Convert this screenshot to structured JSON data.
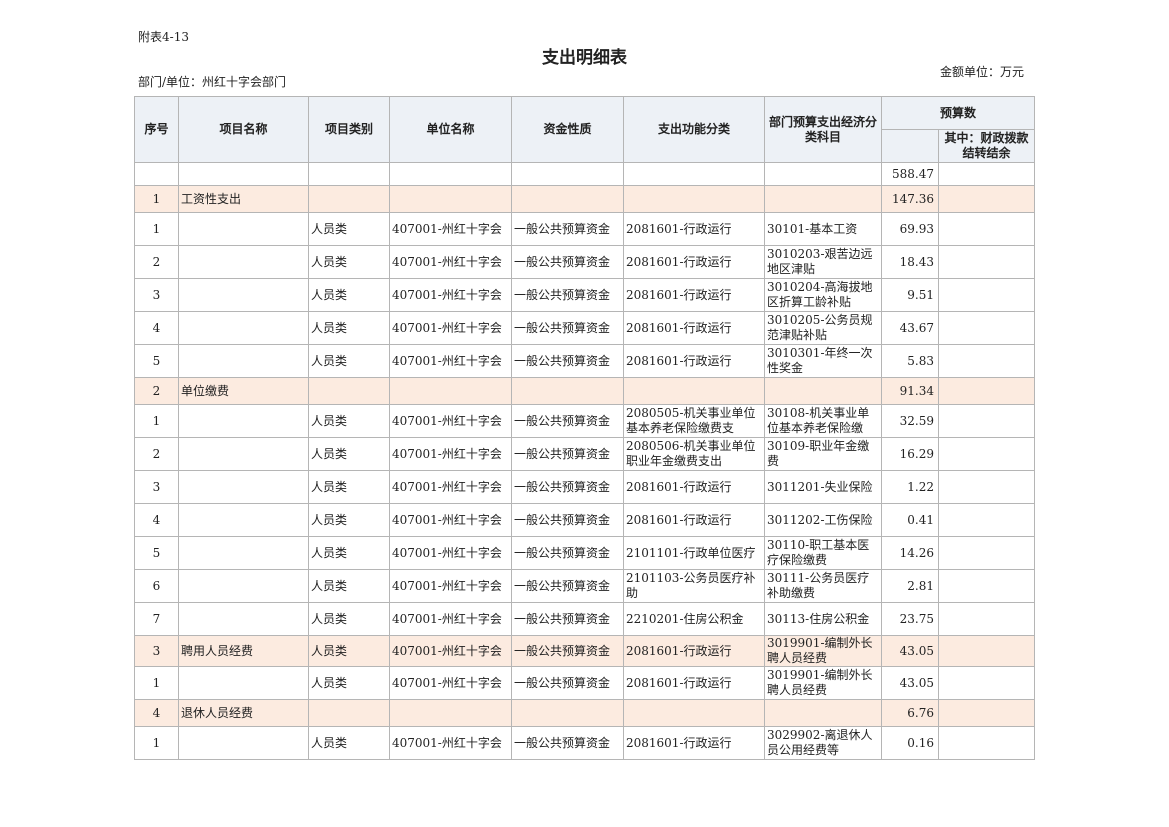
{
  "doc_id": "附表4-13",
  "title": "支出明细表",
  "dept_label": "部门/单位：州红十字会部门",
  "unit_label": "金额单位：万元",
  "headers": {
    "seq": "序号",
    "project_name": "项目名称",
    "project_type": "项目类别",
    "unit_name": "单位名称",
    "fund_nature": "资金性质",
    "function_class": "支出功能分类",
    "econ_class": "部门预算支出经济分类科目",
    "budget": "预算数",
    "budget_sub": "其中：财政拨款结转结余"
  },
  "total": {
    "amount": "588.47"
  },
  "rows": [
    {
      "kind": "cat",
      "seq": "1",
      "name": "工资性支出",
      "type": "",
      "unit": "",
      "fund": "",
      "func": "",
      "econ": "",
      "amount": "147.36"
    },
    {
      "kind": "item",
      "seq": "1",
      "name": "",
      "type": "人员类",
      "unit": "407001-州红十字会",
      "fund": "一般公共预算资金",
      "func": "2081601-行政运行",
      "econ": "30101-基本工资",
      "amount": "69.93"
    },
    {
      "kind": "item",
      "seq": "2",
      "name": "",
      "type": "人员类",
      "unit": "407001-州红十字会",
      "fund": "一般公共预算资金",
      "func": "2081601-行政运行",
      "econ": "3010203-艰苦边远地区津贴",
      "amount": "18.43"
    },
    {
      "kind": "item",
      "seq": "3",
      "name": "",
      "type": "人员类",
      "unit": "407001-州红十字会",
      "fund": "一般公共预算资金",
      "func": "2081601-行政运行",
      "econ": "3010204-高海拔地区折算工龄补贴",
      "amount": "9.51"
    },
    {
      "kind": "item",
      "seq": "4",
      "name": "",
      "type": "人员类",
      "unit": "407001-州红十字会",
      "fund": "一般公共预算资金",
      "func": "2081601-行政运行",
      "econ": "3010205-公务员规范津贴补贴",
      "amount": "43.67"
    },
    {
      "kind": "item",
      "seq": "5",
      "name": "",
      "type": "人员类",
      "unit": "407001-州红十字会",
      "fund": "一般公共预算资金",
      "func": "2081601-行政运行",
      "econ": "3010301-年终一次性奖金",
      "amount": "5.83"
    },
    {
      "kind": "cat",
      "seq": "2",
      "name": "单位缴费",
      "type": "",
      "unit": "",
      "fund": "",
      "func": "",
      "econ": "",
      "amount": "91.34"
    },
    {
      "kind": "item",
      "seq": "1",
      "name": "",
      "type": "人员类",
      "unit": "407001-州红十字会",
      "fund": "一般公共预算资金",
      "func": "2080505-机关事业单位基本养老保险缴费支",
      "econ": "30108-机关事业单位基本养老保险缴",
      "amount": "32.59"
    },
    {
      "kind": "item",
      "seq": "2",
      "name": "",
      "type": "人员类",
      "unit": "407001-州红十字会",
      "fund": "一般公共预算资金",
      "func": "2080506-机关事业单位职业年金缴费支出",
      "econ": "30109-职业年金缴费",
      "amount": "16.29"
    },
    {
      "kind": "item",
      "seq": "3",
      "name": "",
      "type": "人员类",
      "unit": "407001-州红十字会",
      "fund": "一般公共预算资金",
      "func": "2081601-行政运行",
      "econ": "3011201-失业保险",
      "amount": "1.22"
    },
    {
      "kind": "item",
      "seq": "4",
      "name": "",
      "type": "人员类",
      "unit": "407001-州红十字会",
      "fund": "一般公共预算资金",
      "func": "2081601-行政运行",
      "econ": "3011202-工伤保险",
      "amount": "0.41"
    },
    {
      "kind": "item",
      "seq": "5",
      "name": "",
      "type": "人员类",
      "unit": "407001-州红十字会",
      "fund": "一般公共预算资金",
      "func": "2101101-行政单位医疗",
      "econ": "30110-职工基本医疗保险缴费",
      "amount": "14.26"
    },
    {
      "kind": "item",
      "seq": "6",
      "name": "",
      "type": "人员类",
      "unit": "407001-州红十字会",
      "fund": "一般公共预算资金",
      "func": "2101103-公务员医疗补助",
      "econ": "30111-公务员医疗补助缴费",
      "amount": "2.81"
    },
    {
      "kind": "item",
      "seq": "7",
      "name": "",
      "type": "人员类",
      "unit": "407001-州红十字会",
      "fund": "一般公共预算资金",
      "func": "2210201-住房公积金",
      "econ": "30113-住房公积金",
      "amount": "23.75"
    },
    {
      "kind": "cat",
      "seq": "3",
      "name": "聘用人员经费",
      "type": "人员类",
      "unit": "407001-州红十字会",
      "fund": "一般公共预算资金",
      "func": "2081601-行政运行",
      "econ": "3019901-编制外长聘人员经费",
      "amount": "43.05"
    },
    {
      "kind": "item",
      "seq": "1",
      "name": "",
      "type": "人员类",
      "unit": "407001-州红十字会",
      "fund": "一般公共预算资金",
      "func": "2081601-行政运行",
      "econ": "3019901-编制外长聘人员经费",
      "amount": "43.05"
    },
    {
      "kind": "cat",
      "seq": "4",
      "name": "退休人员经费",
      "type": "",
      "unit": "",
      "fund": "",
      "func": "",
      "econ": "",
      "amount": "6.76"
    },
    {
      "kind": "item",
      "seq": "1",
      "name": "",
      "type": "人员类",
      "unit": "407001-州红十字会",
      "fund": "一般公共预算资金",
      "func": "2081601-行政运行",
      "econ": "3029902-离退休人员公用经费等",
      "amount": "0.16"
    }
  ]
}
